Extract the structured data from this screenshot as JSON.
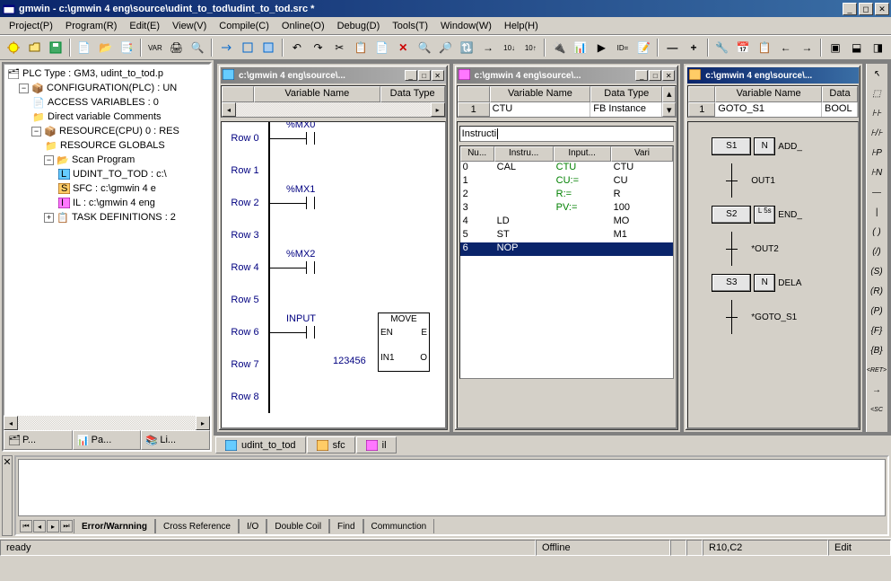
{
  "window": {
    "title": "gmwin - c:\\gmwin 4 eng\\source\\udint_to_tod\\udint_to_tod.src *"
  },
  "menu": {
    "items": [
      "Project(P)",
      "Program(R)",
      "Edit(E)",
      "View(V)",
      "Compile(C)",
      "Online(O)",
      "Debug(D)",
      "Tools(T)",
      "Window(W)",
      "Help(H)"
    ]
  },
  "tree": {
    "n0": "PLC Type : GM3, udint_to_tod.p",
    "n1": "CONFIGURATION(PLC) : UN",
    "n2": "ACCESS VARIABLES :  0",
    "n3": "Direct variable Comments",
    "n4": "RESOURCE(CPU) 0 :  RES",
    "n5": "RESOURCE GLOBALS",
    "n6": "Scan Program",
    "n7": "UDINT_TO_TOD : c:\\",
    "n8": "SFC : c:\\gmwin 4 e",
    "n9": "IL : c:\\gmwin 4 eng",
    "n10": "TASK DEFINITIONS :  2"
  },
  "side_tabs": {
    "t0": "P...",
    "t1": "Pa...",
    "t2": "Li..."
  },
  "mdi": {
    "win1_title": "c:\\gmwin 4 eng\\source\\...",
    "win2_title": "c:\\gmwin 4 eng\\source\\...",
    "win3_title": "c:\\gmwin 4 eng\\source\\...",
    "tabs": {
      "t0": "udint_to_tod",
      "t1": "sfc",
      "t2": "il"
    }
  },
  "ladder": {
    "head_var": "Variable Name",
    "head_type": "Data Type",
    "r0": "Row 0",
    "r1": "Row 1",
    "r2": "Row 2",
    "r3": "Row 3",
    "r4": "Row 4",
    "r5": "Row 5",
    "r6": "Row 6",
    "r7": "Row 7",
    "r8": "Row 8",
    "c0": "%MX0",
    "c1": "%MX1",
    "c2": "%MX2",
    "cinput": "INPUT",
    "fn_move": "MOVE",
    "fn_en": "EN",
    "fn_e": "E",
    "fn_in1": "IN1",
    "fn_o": "O",
    "val": "123456"
  },
  "il": {
    "head_var": "Variable Name",
    "head_type": "Data Type",
    "row0_name": "CTU",
    "row0_type": "FB Instance",
    "input_label": "Instructi",
    "h_num": "Nu...",
    "h_instr": "Instru...",
    "h_input": "Input...",
    "h_vari": "Vari",
    "rows": [
      {
        "n": "0",
        "i": "CAL",
        "in": "CTU",
        "v": "CTU"
      },
      {
        "n": "1",
        "i": "",
        "in": "CU:=",
        "v": "CU"
      },
      {
        "n": "2",
        "i": "",
        "in": "R:=",
        "v": "R"
      },
      {
        "n": "3",
        "i": "",
        "in": "PV:=",
        "v": "100"
      },
      {
        "n": "4",
        "i": "LD",
        "in": "",
        "v": "MO"
      },
      {
        "n": "5",
        "i": "ST",
        "in": "",
        "v": "M1"
      },
      {
        "n": "6",
        "i": "NOP",
        "in": "",
        "v": ""
      }
    ]
  },
  "sfc": {
    "head_var": "Variable Name",
    "head_type": "Data",
    "row0_name": "GOTO_S1",
    "row0_type": "BOOL",
    "s1": "S1",
    "n1": "N",
    "a1": "ADD_",
    "t1": "OUT1",
    "s2": "S2",
    "n2": "L 5s",
    "a2": "END_",
    "t2": "*OUT2",
    "s3": "S3",
    "n3": "N",
    "a3": "DELA",
    "t3": "*GOTO_S1"
  },
  "output_tabs": {
    "t0": "Error/Warnning",
    "t1": "Cross Reference",
    "t2": "I/O",
    "t3": "Double Coil",
    "t4": "Find",
    "t5": "Communction"
  },
  "status": {
    "ready": "ready",
    "offline": "Offline",
    "pos": "R10,C2",
    "mode": "Edit"
  }
}
